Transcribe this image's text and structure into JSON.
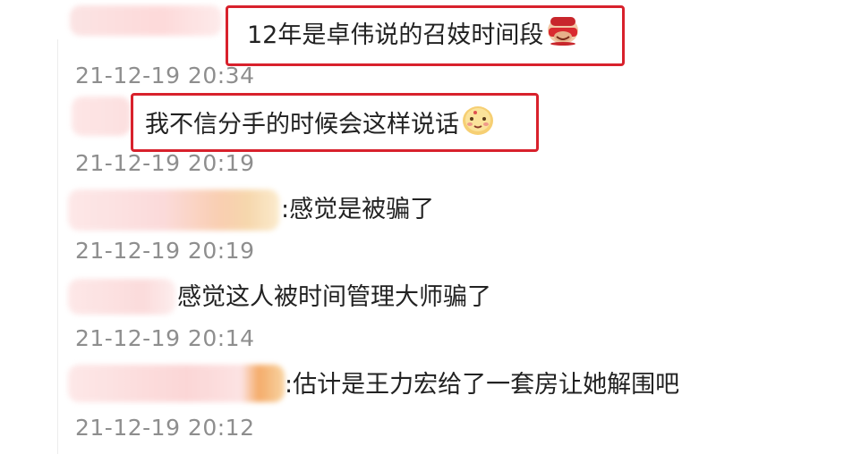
{
  "comments": [
    {
      "text": "12年是卓伟说的召妓时间段",
      "emoji": "red-lantern-face-icon",
      "timestamp": "21-12-19 20:34",
      "highlighted": true
    },
    {
      "text": "我不信分手的时候会这样说话",
      "emoji": "shy-face-icon",
      "timestamp": "21-12-19 20:19",
      "highlighted": true
    },
    {
      "text": ":感觉是被骗了",
      "timestamp": "21-12-19 20:19",
      "highlighted": false
    },
    {
      "text": "感觉这人被时间管理大师骗了",
      "timestamp": "21-12-19 20:14",
      "highlighted": false
    },
    {
      "text": ":估计是王力宏给了一套房让她解围吧",
      "timestamp": "21-12-19 20:12",
      "highlighted": false
    }
  ],
  "colors": {
    "highlight_border": "#d8212c",
    "timestamp_text": "#8e8e8e",
    "comment_text": "#222222"
  }
}
